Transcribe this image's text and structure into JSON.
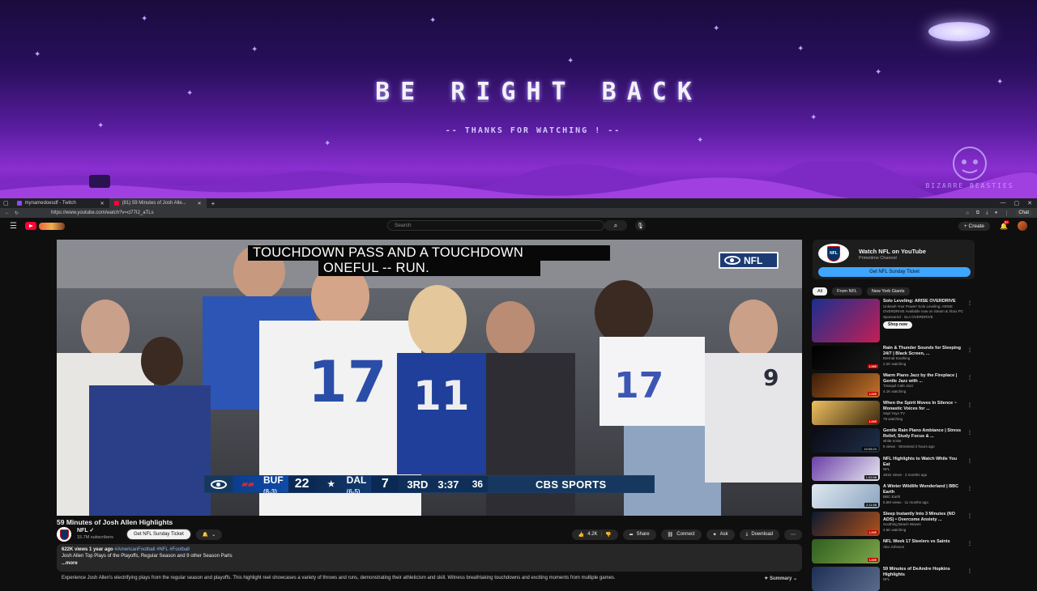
{
  "overlay": {
    "title": "BE RIGHT BACK",
    "subtitle": "-- THANKS FOR WATCHING ! --",
    "badge": "BIZARRE BEASTIES"
  },
  "browser": {
    "tabs": [
      {
        "label": "mynamedoesdf - Twitch",
        "active": false
      },
      {
        "label": "(81) 59 Minutes of Josh Alle...",
        "active": true
      }
    ],
    "url": "https://www.youtube.com/watch?v=cl77I2_aTLs",
    "chat_label": "Chat"
  },
  "masthead": {
    "search_placeholder": "Search",
    "create_label": "Create",
    "notif_count": "9+"
  },
  "player": {
    "caption_line1": "TOUCHDOWN PASS AND A TOUCHDOWN",
    "caption_line2": "ONEFUL -- RUN.",
    "network_bug": "NFL",
    "scorebug": {
      "home_abbr": "BUF",
      "home_record": "(8-3)",
      "home_score": "22",
      "away_abbr": "DAL",
      "away_record": "(6-5)",
      "away_score": "7",
      "quarter": "3RD",
      "clock": "3:37",
      "play_clock": "36",
      "network": "CBS SPORTS"
    }
  },
  "video": {
    "title": "59 Minutes of Josh Allen Highlights",
    "channel": "NFL",
    "subscribers": "15.7M subscribers",
    "ticket_btn": "Get NFL Sunday Ticket",
    "likes": "4.2K",
    "share": "Share",
    "connect": "Connect",
    "ask": "Ask",
    "download": "Download",
    "stats": "622K views  1 year ago",
    "tags": "#AmericanFootball #NFL #Football",
    "desc_line1": "Josh Allen Top Plays of the Playoffs, Regular Season and 9 other Season Parts",
    "more": "...more",
    "desc_line2": "Experience Josh Allen's electrifying plays from the regular season and playoffs. This highlight reel showcases a variety of throws and runs, demonstrating their athleticism and skill. Witness breathtaking touchdowns and exciting moments from multiple games.",
    "summary": "Summary"
  },
  "sidebar": {
    "promo_title": "Watch NFL on YouTube",
    "promo_sub": "Primetime Channel",
    "promo_btn": "Get NFL Sunday Ticket",
    "chips": [
      "All",
      "From NFL",
      "New York Giants"
    ],
    "recs": [
      {
        "title": "Solo Leveling: ARISE OVERDRIVE",
        "line2": "Unleash Your Power! Solo Leveling: ARISE OVERDRIVE Available now on Steam & Xbox PC",
        "line3": "Sponsored · SLA OVERDRIVE",
        "badge": "",
        "shop": "Shop now",
        "thumb_a": "#1b2f8f",
        "thumb_b": "#c21f55"
      },
      {
        "title": "Rain & Thunder Sounds for Sleeping 24/7 | Black Screen, ...",
        "line2": "Eternal Soothing",
        "line3": "2.2K watching",
        "badge": "LIVE",
        "shop": "",
        "thumb_a": "#000000",
        "thumb_b": "#1a1a1a"
      },
      {
        "title": "Warm Piano Jazz by the Fireplace | Gentle Jazz with ...",
        "line2": "Tranquil Cafe Jazz",
        "line3": "4.1K watching",
        "badge": "LIVE",
        "shop": "",
        "thumb_a": "#3b1c08",
        "thumb_b": "#c4722a"
      },
      {
        "title": "When the Spirit Moves In Silence ~ Monastic Voices for ...",
        "line2": "Sapi Yoyo TV",
        "line3": "79 watching",
        "badge": "LIVE",
        "shop": "",
        "thumb_a": "#f0c060",
        "thumb_b": "#3a2a10"
      },
      {
        "title": "Gentle Rain Piano Ambiance | Stress Relief, Study Focus & ...",
        "line2": "white noise",
        "line3": "5 views · Streamed 2 hours ago",
        "badge": "10:05:24",
        "shop": "",
        "thumb_a": "#0a0a14",
        "thumb_b": "#20304a"
      },
      {
        "title": "NFL Highlights to Watch While You Eat",
        "line2": "NFL",
        "line3": "481K views · 3 months ago",
        "badge": "1:02:58",
        "shop": "",
        "thumb_a": "#6a3fa8",
        "thumb_b": "#e8e8f0"
      },
      {
        "title": "A Winter Wildlife Wonderland | BBC Earth",
        "line2": "BBC Earth",
        "line3": "5.6M views · 11 months ago",
        "badge": "2:11:58",
        "shop": "",
        "thumb_a": "#dfe8f0",
        "thumb_b": "#8aa4bf"
      },
      {
        "title": "Sleep Instantly Into 3 Minutes (NO ADS) • Overcome Anxiety ...",
        "line2": "Soothing Beach Waves",
        "line3": "4.6K watching",
        "badge": "LIVE",
        "shop": "",
        "thumb_a": "#0c1a2e",
        "thumb_b": "#b0521c"
      },
      {
        "title": "NFL Week 17 Steelers vs Saints",
        "line2": "Abo Johnson",
        "line3": "",
        "badge": "LIVE",
        "shop": "",
        "thumb_a": "#2f5e1f",
        "thumb_b": "#7da64a"
      },
      {
        "title": "59 Minutes of DeAndre Hopkins Highlights",
        "line2": "NFL",
        "line3": "",
        "badge": "",
        "shop": "",
        "thumb_a": "#1e2f55",
        "thumb_b": "#5a6c8c"
      }
    ]
  }
}
